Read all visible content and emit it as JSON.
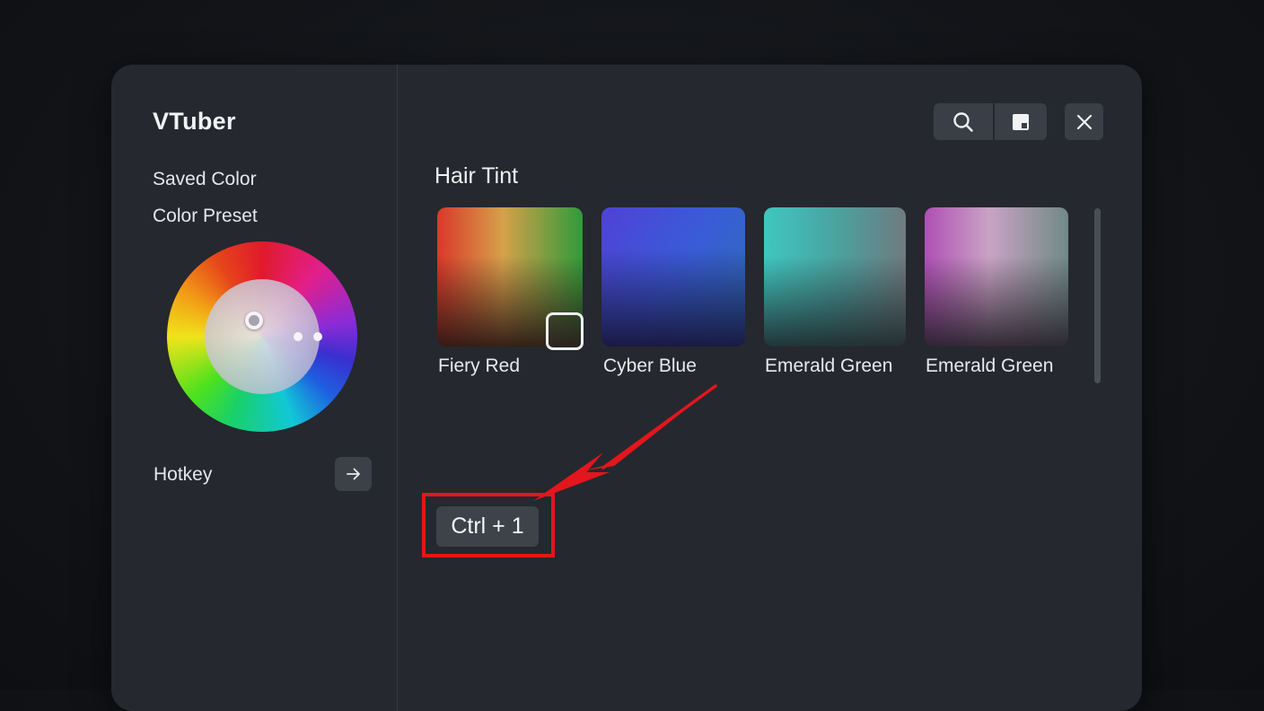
{
  "app": {
    "title": "VTuber"
  },
  "sidebar": {
    "items": [
      {
        "label": "Saved Color"
      },
      {
        "label": "Color Preset"
      }
    ],
    "hotkey_label": "Hotkey"
  },
  "toolbar": {
    "icons": [
      "search-icon",
      "panel-icon",
      "close-icon"
    ]
  },
  "main": {
    "section_title": "Hair Tint",
    "swatches": [
      {
        "label": "Fiery Red",
        "selected": true
      },
      {
        "label": "Cyber Blue",
        "selected": false
      },
      {
        "label": "Emerald Green",
        "selected": false
      },
      {
        "label": "Emerald Green",
        "selected": false
      }
    ],
    "hotkey_value": "Ctrl + 1"
  },
  "colors": {
    "window_bg": "#25282e",
    "accent_annotation": "#e3161d",
    "button_bg": "#3a3e47"
  }
}
